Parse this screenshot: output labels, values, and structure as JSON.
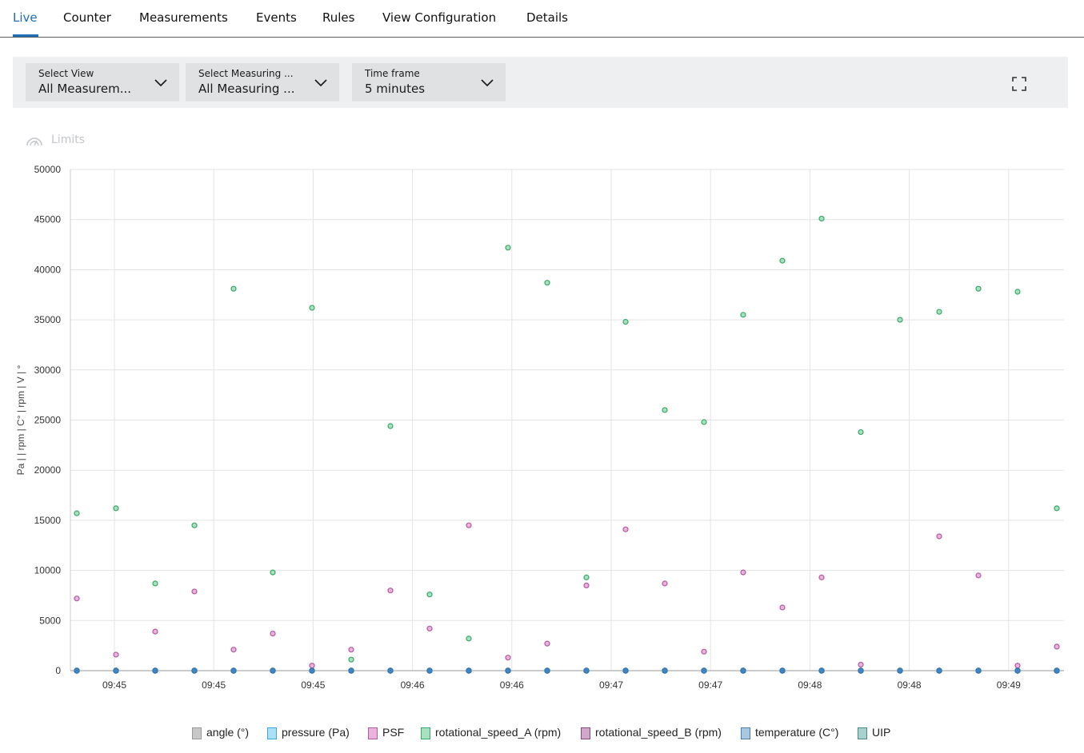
{
  "tabs": [
    {
      "label": "Live",
      "active": true
    },
    {
      "label": "Counter"
    },
    {
      "label": "Measurements"
    },
    {
      "label": "Events"
    },
    {
      "label": "Rules"
    },
    {
      "label": "View Configuration"
    },
    {
      "label": "Details"
    }
  ],
  "toolbar": {
    "select_view": {
      "label": "Select View",
      "value": "All Measurem..."
    },
    "select_measuring": {
      "label": "Select Measuring ...",
      "value": "All Measuring ..."
    },
    "time_frame": {
      "label": "Time frame",
      "value": "5 minutes"
    },
    "fullscreen_icon": "fullscreen-icon"
  },
  "limits": {
    "label": "Limits",
    "icon": "gauge-icon"
  },
  "colors": {
    "accent": "#1d6fb8"
  },
  "chart_data": {
    "type": "scatter",
    "ylabel": "Pa |  | rpm | C° | rpm | V | °",
    "ylim": [
      0,
      50000
    ],
    "yticks": [
      0,
      5000,
      10000,
      15000,
      20000,
      25000,
      30000,
      35000,
      40000,
      45000,
      50000
    ],
    "xticks": [
      "09:45",
      "09:45",
      "09:45",
      "09:46",
      "09:46",
      "09:47",
      "09:47",
      "09:48",
      "09:48",
      "09:49",
      "09:49"
    ],
    "grid": true,
    "legend": "bottom",
    "series": [
      {
        "name": "angle (°)",
        "color": "#c8c8c8",
        "border": "#999999",
        "values": [
          0,
          0,
          0,
          0,
          0,
          0,
          0,
          0,
          0,
          0,
          0,
          0,
          0,
          0,
          0,
          0,
          0,
          0,
          0,
          0,
          0,
          0,
          0,
          0,
          0,
          0
        ]
      },
      {
        "name": "pressure (Pa)",
        "color": "#aee0f5",
        "border": "#3aa7d8",
        "values": [
          0,
          0,
          0,
          0,
          0,
          0,
          0,
          0,
          0,
          0,
          0,
          0,
          0,
          0,
          0,
          0,
          0,
          0,
          0,
          0,
          0,
          0,
          0,
          0,
          0,
          0
        ]
      },
      {
        "name": "PSF",
        "color": "#e8b4dc",
        "border": "#b35aa1",
        "values": [
          7200,
          1600,
          3900,
          7900,
          2100,
          3700,
          500,
          2100,
          8000,
          4200,
          14500,
          1300,
          2700,
          8500,
          14100,
          8700,
          1900,
          9800,
          6300,
          9300,
          600,
          null,
          13400,
          9500,
          500,
          2400
        ]
      },
      {
        "name": "rotational_speed_A (rpm)",
        "color": "#a8e0c0",
        "border": "#3aa86a",
        "values": [
          15700,
          16200,
          8700,
          14500,
          38100,
          9800,
          36200,
          1100,
          24400,
          7600,
          3200,
          42200,
          38700,
          9300,
          34800,
          26000,
          24800,
          35500,
          40900,
          45100,
          23800,
          35000,
          35800,
          38100,
          37800,
          16200
        ]
      },
      {
        "name": "rotational_speed_B (rpm)",
        "color": "#d0a8c8",
        "border": "#8a4a80",
        "values": [
          0,
          0,
          0,
          0,
          0,
          0,
          0,
          0,
          0,
          0,
          0,
          0,
          0,
          0,
          0,
          0,
          0,
          0,
          0,
          0,
          0,
          0,
          0,
          0,
          0,
          0
        ]
      },
      {
        "name": "temperature (C°)",
        "color": "#a8c8e0",
        "border": "#4a7fa8",
        "values": [
          0,
          0,
          0,
          0,
          0,
          0,
          0,
          0,
          0,
          0,
          0,
          0,
          0,
          0,
          0,
          0,
          0,
          0,
          0,
          0,
          0,
          0,
          0,
          0,
          0,
          0
        ]
      },
      {
        "name": "UIP",
        "color": "#a8d0cc",
        "border": "#4a8a84",
        "values": [
          0,
          0,
          0,
          0,
          0,
          0,
          0,
          0,
          0,
          0,
          0,
          0,
          0,
          0,
          0,
          0,
          0,
          0,
          0,
          0,
          0,
          0,
          0,
          0,
          0,
          0
        ]
      }
    ]
  }
}
